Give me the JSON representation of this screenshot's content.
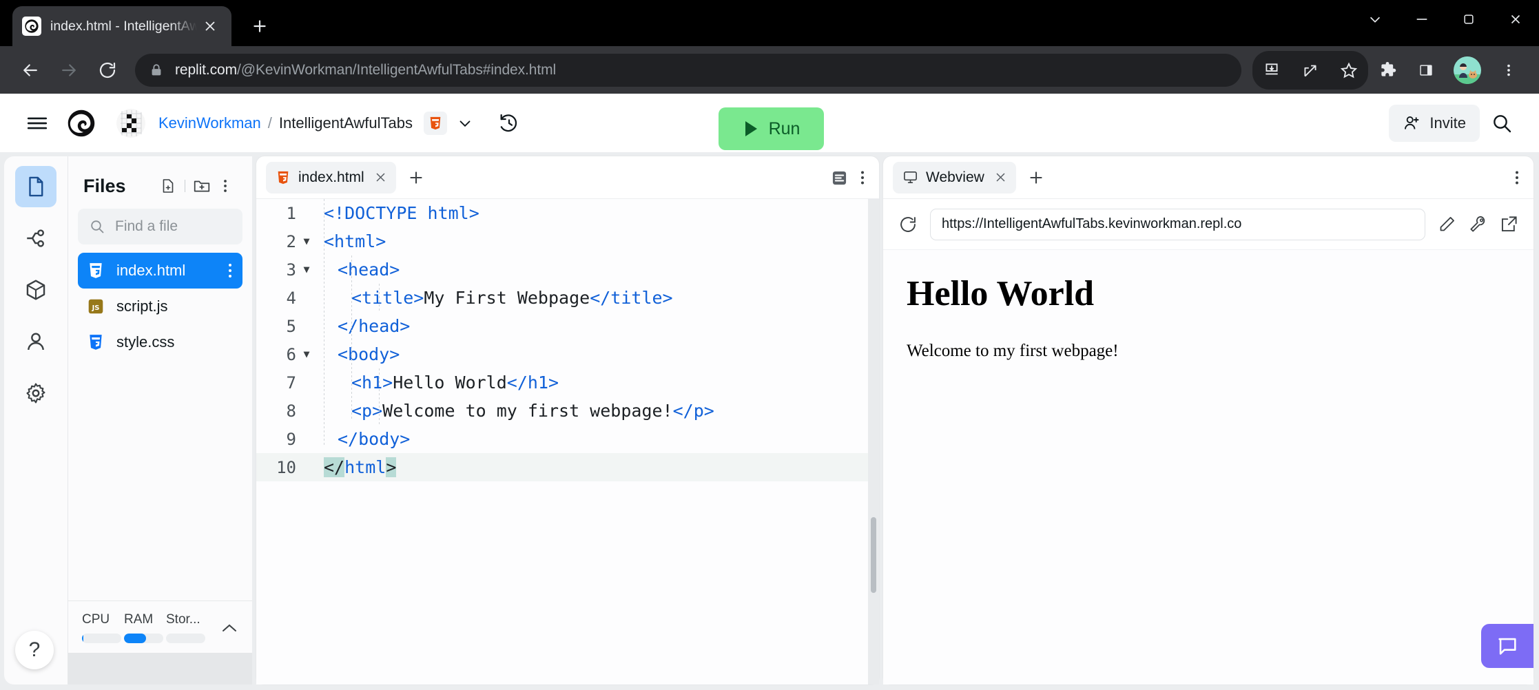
{
  "browser": {
    "tab": {
      "title": "index.html - IntelligentAwfulTabs",
      "favicon_icon": "replit-favicon-icon",
      "close_icon": "close-icon"
    },
    "new_tab_icon": "plus-icon",
    "window_controls": [
      {
        "name": "tab-search-button",
        "icon": "chevron-down-icon"
      },
      {
        "name": "minimize-button",
        "icon": "minimize-icon"
      },
      {
        "name": "maximize-button",
        "icon": "maximize-icon"
      },
      {
        "name": "close-window-button",
        "icon": "close-icon"
      }
    ],
    "nav": {
      "back_icon": "arrow-left-icon",
      "forward_icon": "arrow-right-icon",
      "reload_icon": "reload-icon",
      "lock_icon": "lock-icon",
      "url_domain": "replit.com",
      "url_path": "/@KevinWorkman/IntelligentAwfulTabs#index.html",
      "url_full": "replit.com/@KevinWorkman/IntelligentAwfulTabs#index.html"
    },
    "toolbar_icons": [
      {
        "name": "install-app-button",
        "icon": "install-icon"
      },
      {
        "name": "share-button",
        "icon": "share-icon"
      },
      {
        "name": "bookmark-button",
        "icon": "star-icon"
      },
      {
        "name": "extensions-button",
        "icon": "puzzle-icon"
      },
      {
        "name": "side-panel-button",
        "icon": "side-panel-icon"
      },
      {
        "name": "profile-button",
        "icon": "avatar-icon"
      },
      {
        "name": "chrome-menu-button",
        "icon": "kebab-menu-icon"
      }
    ]
  },
  "app_header": {
    "menu_icon": "hamburger-menu-icon",
    "logo_icon": "replit-logo-icon",
    "repl_avatar_icon": "repl-cover-avatar-icon",
    "breadcrumb": {
      "user": "KevinWorkman",
      "separator": "/",
      "repl": "IntelligentAwfulTabs"
    },
    "language_chip_icon": "html5-icon",
    "chevron_icon": "chevron-down-icon",
    "history_icon": "history-icon",
    "run_label": "Run",
    "run_icon": "play-icon",
    "run_color": "#7ae88f",
    "run_text_color": "#0b5c28",
    "invite_label": "Invite",
    "invite_icon": "person-plus-icon",
    "search_icon": "search-icon"
  },
  "rail": {
    "items": [
      {
        "name": "sidebar-item-files",
        "icon": "file-icon",
        "active": true
      },
      {
        "name": "sidebar-item-version-control",
        "icon": "git-branch-icon",
        "active": false
      },
      {
        "name": "sidebar-item-packages",
        "icon": "package-cube-icon",
        "active": false
      },
      {
        "name": "sidebar-item-account",
        "icon": "person-icon",
        "active": false
      },
      {
        "name": "sidebar-item-settings",
        "icon": "gear-icon",
        "active": false
      }
    ],
    "active_bg": "#bedcfb",
    "help_label": "?"
  },
  "files_panel": {
    "title": "Files",
    "new_file_icon": "new-file-icon",
    "new_folder_icon": "new-folder-icon",
    "more_icon": "kebab-menu-icon",
    "search": {
      "placeholder": "Find a file",
      "value": "",
      "icon": "search-icon"
    },
    "files": [
      {
        "name": "index.html",
        "icon": "html5-file-icon",
        "selected": true
      },
      {
        "name": "script.js",
        "icon": "js-file-icon",
        "selected": false
      },
      {
        "name": "style.css",
        "icon": "css-file-icon",
        "selected": false
      }
    ],
    "selected_color": "#0d84f8",
    "resources": [
      {
        "label": "CPU",
        "percent": 4
      },
      {
        "label": "RAM",
        "percent": 57
      },
      {
        "label": "Stor...",
        "percent": 0
      }
    ],
    "resources_collapse_icon": "chevron-up-icon",
    "resource_bar_color": "#0d84f8"
  },
  "editor": {
    "tab": {
      "label": "index.html",
      "icon": "html5-file-icon",
      "close_icon": "close-icon"
    },
    "new_tab_icon": "plus-icon",
    "format_icon": "format-document-icon",
    "more_icon": "kebab-menu-icon",
    "active_line": 10,
    "lines": [
      {
        "num": 1,
        "fold": "",
        "indent": 0,
        "tokens": [
          {
            "t": "<!DOCTYPE html>",
            "c": "tk-doctype"
          }
        ]
      },
      {
        "num": 2,
        "fold": "▼",
        "indent": 0,
        "tokens": [
          {
            "t": "<html>",
            "c": "tk-tag"
          }
        ]
      },
      {
        "num": 3,
        "fold": "▼",
        "indent": 1,
        "tokens": [
          {
            "t": "<head>",
            "c": "tk-tag"
          }
        ]
      },
      {
        "num": 4,
        "fold": "",
        "indent": 2,
        "tokens": [
          {
            "t": "<title>",
            "c": "tk-tag"
          },
          {
            "t": "My First Webpage",
            "c": "tk-txt"
          },
          {
            "t": "</title>",
            "c": "tk-tag"
          }
        ]
      },
      {
        "num": 5,
        "fold": "",
        "indent": 1,
        "tokens": [
          {
            "t": "</head>",
            "c": "tk-tag"
          }
        ]
      },
      {
        "num": 6,
        "fold": "▼",
        "indent": 1,
        "tokens": [
          {
            "t": "<body>",
            "c": "tk-tag"
          }
        ]
      },
      {
        "num": 7,
        "fold": "",
        "indent": 2,
        "tokens": [
          {
            "t": "<h1>",
            "c": "tk-tag"
          },
          {
            "t": "Hello World",
            "c": "tk-txt"
          },
          {
            "t": "</h1>",
            "c": "tk-tag"
          }
        ]
      },
      {
        "num": 8,
        "fold": "",
        "indent": 2,
        "tokens": [
          {
            "t": "<p>",
            "c": "tk-tag"
          },
          {
            "t": "Welcome to my first webpage!",
            "c": "tk-txt"
          },
          {
            "t": "</p>",
            "c": "tk-tag"
          }
        ]
      },
      {
        "num": 9,
        "fold": "",
        "indent": 1,
        "tokens": [
          {
            "t": "</body>",
            "c": "tk-tag"
          }
        ]
      },
      {
        "num": 10,
        "fold": "",
        "indent": 0,
        "tokens": [
          {
            "t": "</",
            "c": "tk-match"
          },
          {
            "t": "html",
            "c": "tk-tag"
          },
          {
            "t": ">",
            "c": "tk-match"
          }
        ]
      }
    ],
    "code_plain": "<!DOCTYPE html>\n<html>\n  <head>\n    <title>My First Webpage</title>\n  </head>\n  <body>\n    <h1>Hello World</h1>\n    <p>Welcome to my first webpage!</p>\n  </body>\n</html>"
  },
  "webview": {
    "tab": {
      "label": "Webview",
      "icon": "monitor-icon",
      "close_icon": "close-icon"
    },
    "new_tab_icon": "plus-icon",
    "more_icon": "kebab-menu-icon",
    "reload_icon": "reload-icon",
    "url": "https://IntelligentAwfulTabs.kevinworkman.repl.co",
    "actions": [
      {
        "name": "edit-url-button",
        "icon": "pencil-icon"
      },
      {
        "name": "devtools-button",
        "icon": "wrench-icon"
      },
      {
        "name": "open-new-tab-button",
        "icon": "external-link-icon"
      }
    ],
    "content": {
      "heading": "Hello World",
      "paragraph": "Welcome to my first webpage!"
    },
    "chat_icon": "chat-bubble-icon",
    "chat_color": "#7d6cf5"
  }
}
